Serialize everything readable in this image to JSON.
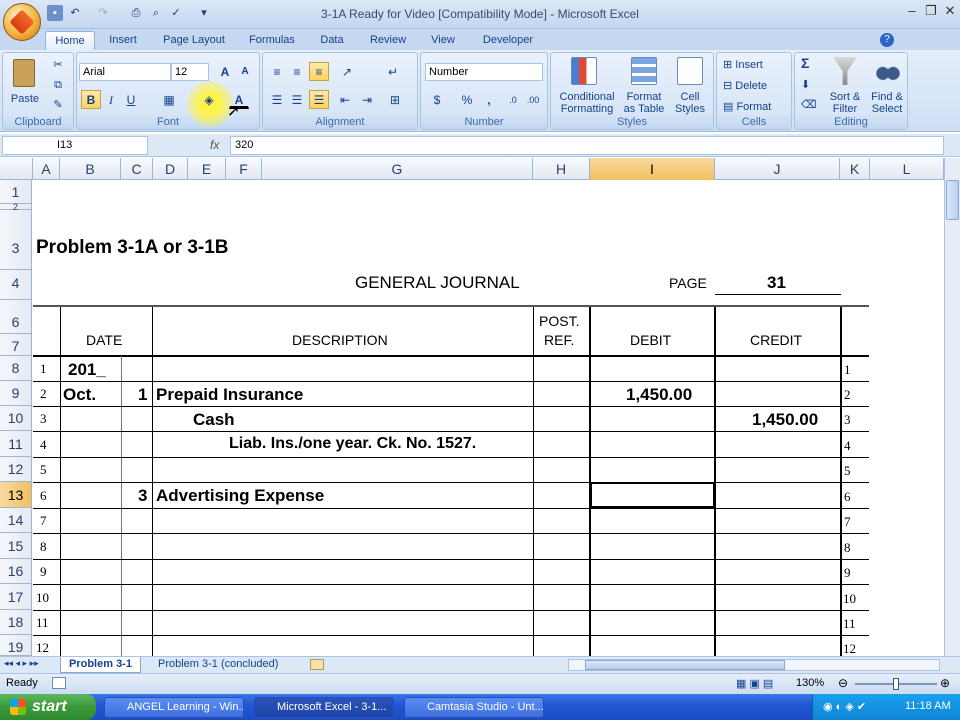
{
  "window": {
    "title": "3-1A Ready for Video  [Compatibility Mode] - Microsoft Excel",
    "controls": {
      "minimize": "–",
      "maximize": "❐",
      "close": "✕"
    }
  },
  "tabs": [
    "Home",
    "Insert",
    "Page Layout",
    "Formulas",
    "Data",
    "Review",
    "View",
    "Developer"
  ],
  "ribbon": {
    "clipboard": {
      "label": "Clipboard",
      "paste": "Paste"
    },
    "font": {
      "label": "Font",
      "name": "Arial",
      "size": "12",
      "bold": "B",
      "italic": "I",
      "underline": "U"
    },
    "alignment": {
      "label": "Alignment"
    },
    "number": {
      "label": "Number",
      "format": "Number",
      "currency": "$",
      "percent": "%",
      "comma": ","
    },
    "styles": {
      "label": "Styles",
      "conditional": [
        "Conditional",
        "Formatting"
      ],
      "format_table": [
        "Format",
        "as Table"
      ],
      "cell_styles": [
        "Cell",
        "Styles"
      ]
    },
    "cells": {
      "label": "Cells",
      "insert": "Insert",
      "delete": "Delete",
      "format": "Format"
    },
    "editing": {
      "label": "Editing",
      "sigma": "Σ",
      "sort": [
        "Sort &",
        "Filter"
      ],
      "find": [
        "Find &",
        "Select"
      ]
    }
  },
  "formula_bar": {
    "name_box": "I13",
    "fx": "fx",
    "value": "320"
  },
  "columns": [
    "A",
    "B",
    "C",
    "D",
    "E",
    "F",
    "G",
    "H",
    "I",
    "J",
    "K",
    "L"
  ],
  "selected_column": "I",
  "rows": [
    "1",
    "2",
    "3",
    "4",
    "6",
    "7",
    "8",
    "9",
    "10",
    "11",
    "12",
    "13",
    "14",
    "15",
    "16",
    "17",
    "18",
    "19"
  ],
  "selected_row": "13",
  "sheet": {
    "problem": "Problem 3-1A or 3-1B",
    "journal_title": "GENERAL JOURNAL",
    "page_label": "PAGE",
    "page_number": "31",
    "headers": {
      "date": "DATE",
      "description": "DESCRIPTION",
      "post": "POST.",
      "ref": "REF.",
      "debit": "DEBIT",
      "credit": "CREDIT"
    },
    "line_numbers": [
      "1",
      "2",
      "3",
      "4",
      "5",
      "6",
      "7",
      "8",
      "9",
      "10",
      "11",
      "12"
    ],
    "entries": [
      {
        "line": 1,
        "month": "201_",
        "day": "",
        "description": "",
        "debit": "",
        "credit": ""
      },
      {
        "line": 2,
        "month": "Oct.",
        "day": "1",
        "description": "Prepaid Insurance",
        "debit": "1,450.00",
        "credit": ""
      },
      {
        "line": 3,
        "month": "",
        "day": "",
        "description": "Cash",
        "debit": "",
        "credit": "1,450.00"
      },
      {
        "line": 4,
        "month": "",
        "day": "",
        "description": "Liab. Ins./one year. Ck. No. 1527.",
        "debit": "",
        "credit": ""
      },
      {
        "line": 6,
        "month": "",
        "day": "3",
        "description": "Advertising Expense",
        "debit": "",
        "credit": ""
      }
    ]
  },
  "sheet_tabs": [
    "Problem 3-1",
    "Problem 3-1 (concluded)"
  ],
  "status": {
    "ready": "Ready",
    "zoom": "130%"
  },
  "taskbar": {
    "start": "start",
    "items": [
      "ANGEL Learning - Win...",
      "Microsoft Excel - 3-1...",
      "Camtasia Studio - Unt..."
    ],
    "clock": "11:18 AM"
  }
}
